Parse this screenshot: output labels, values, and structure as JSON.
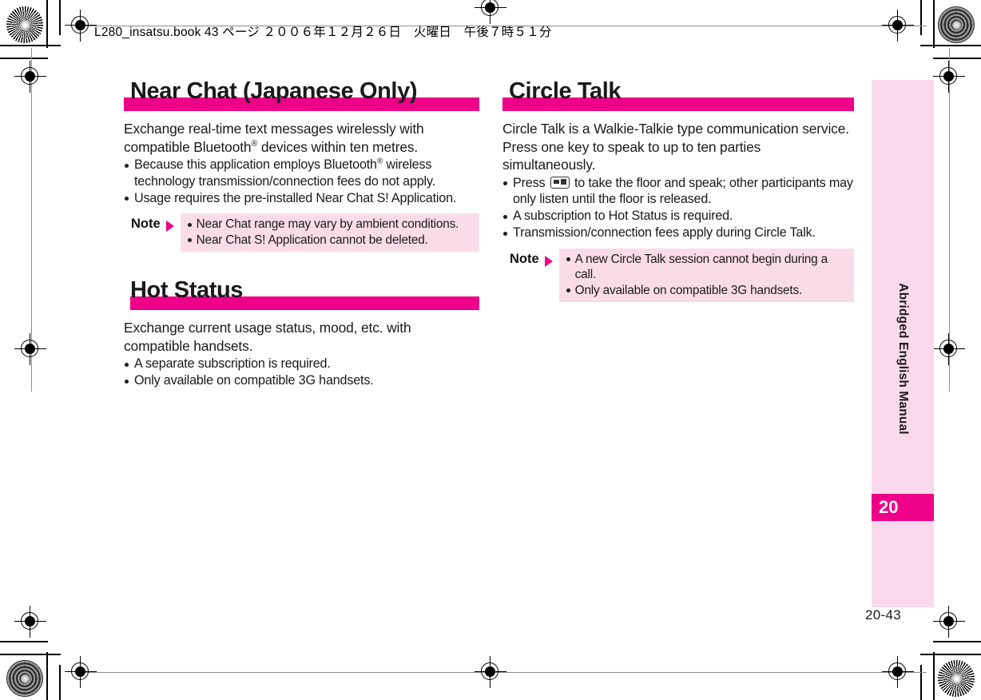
{
  "header": {
    "text": "L280_insatsu.book  43 ページ  ２００６年１２月２６日　火曜日　午後７時５１分"
  },
  "colors": {
    "magenta": "#ee0088",
    "note_bg": "#fadce9",
    "tab_bg": "#fbd9ec"
  },
  "left_column": {
    "sections": [
      {
        "title": "Near Chat (Japanese Only)",
        "lead": "Exchange real-time text messages wirelessly with compatible Bluetooth",
        "lead_sup": "®",
        "lead_tail": " devices within ten metres.",
        "bullets": [
          {
            "pre": "Because this application employs Bluetooth",
            "sup": "®",
            "post": " wireless technology transmission/connection fees do not apply."
          },
          {
            "pre": "Usage requires the pre-installed Near Chat S! Application.",
            "sup": "",
            "post": ""
          }
        ],
        "note": {
          "label": "Note",
          "items": [
            "Near Chat range may vary by ambient conditions.",
            "Near Chat S! Application cannot be deleted."
          ]
        }
      },
      {
        "title": "Hot Status",
        "lead": "Exchange current usage status, mood, etc. with compatible handsets.",
        "bullets": [
          {
            "pre": "A separate subscription is required.",
            "sup": "",
            "post": ""
          },
          {
            "pre": "Only available on compatible 3G handsets.",
            "sup": "",
            "post": ""
          }
        ]
      }
    ]
  },
  "right_column": {
    "sections": [
      {
        "title": "Circle Talk",
        "lead": "Circle Talk is a Walkie-Talkie type communication service. Press one key to speak to up to ten parties simultaneously.",
        "bullets": [
          {
            "pre": "Press ",
            "keycap": "side-key-icon",
            "post": " to take the floor and speak; other participants may only listen until the floor is released."
          },
          {
            "pre": "A subscription to Hot Status is required.",
            "post": ""
          },
          {
            "pre": "Transmission/connection fees apply during Circle Talk.",
            "post": ""
          }
        ],
        "note": {
          "label": "Note",
          "items": [
            "A new Circle Talk session cannot begin during a call.",
            "Only available on compatible 3G handsets."
          ]
        }
      }
    ]
  },
  "chapter_tab": {
    "vertical_label": "Abridged English Manual",
    "number": "20"
  },
  "folio": {
    "page_number": "20-43"
  }
}
